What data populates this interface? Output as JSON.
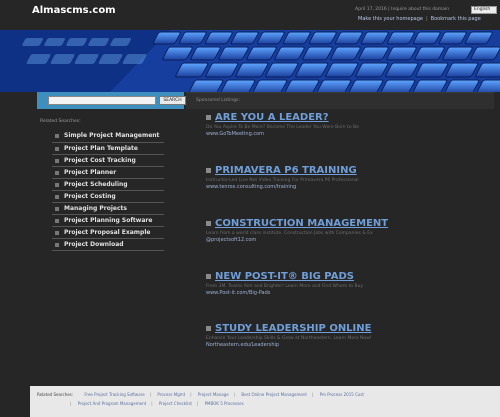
{
  "header": {
    "site_title": "Almascms.com",
    "date_text": "April 17, 2016 | Inquire about this domain",
    "language": "English",
    "links": [
      "Make this your homepage",
      "Bookmark this page"
    ]
  },
  "sidebar": {
    "search_placeholder": "",
    "search_button": "SEARCH",
    "heading": "Related Searches:",
    "items": [
      "Simple Project Management",
      "Project Plan Template",
      "Project Cost Tracking",
      "Project Planner",
      "Project Scheduling",
      "Project Costing",
      "Managing Projects",
      "Project Planning Software",
      "Project Proposal Example",
      "Project Download"
    ]
  },
  "main": {
    "strip_label": "Sponsored Listings:",
    "listings": [
      {
        "title": "ARE YOU A LEADER?",
        "desc": "Do You Aspire To Be More? Become The Leader You Were Born to Be",
        "url": "www.GoToMeeting.com"
      },
      {
        "title": "PRIMAVERA P6 TRAINING",
        "desc": "Instructor-Led Live Net Video Training For Primavera P6 Professional",
        "url": "www.tenrox.consulting.com/training"
      },
      {
        "title": "CONSTRUCTION MANAGEMENT",
        "desc": "Learn from a world class institute. Construction Jobs with Companies & Ex",
        "url": "@projectsoft12.com"
      },
      {
        "title": "NEW POST-IT® BIG PADS",
        "desc": "From 3M. Teams Aim and Brighter! Learn More and Find Where to Buy",
        "url": "www.Post-it.com/Big-Pads"
      },
      {
        "title": "STUDY LEADERSHIP ONLINE",
        "desc": "Enhance Your Leadership Skills & Grow at Northeastern. Learn More Now!",
        "url": "Northeastern.edu/Leadership"
      }
    ]
  },
  "footer": {
    "label": "Related Searches:",
    "row1": [
      "Free Project Tracking Software",
      "Process Mgmt",
      "Project Manage",
      "Best Online Project Management",
      "Pm Process 2015 Cost"
    ],
    "row2": [
      "Project And Program Management",
      "Project Checklist",
      "PMBOK 5 Processes"
    ]
  },
  "colors": {
    "background": "#262626",
    "accent_blue": "#3e8fbd",
    "link_blue": "#6f9ed8",
    "banner_blue": "#1b56c9"
  }
}
